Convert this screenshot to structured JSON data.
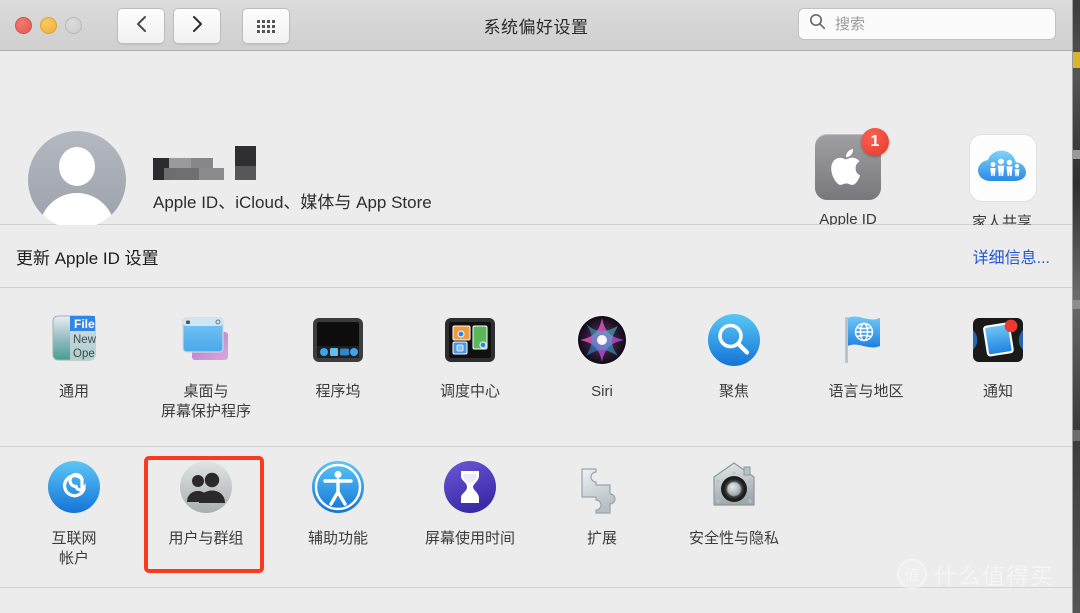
{
  "window": {
    "title": "系统偏好设置",
    "traffic_lights": [
      {
        "name": "close",
        "color": "#e15a52"
      },
      {
        "name": "minimize",
        "color": "#f0b03a"
      },
      {
        "name": "zoom",
        "color": "#cbcbcb"
      }
    ],
    "nav": {
      "back_icon": "chevron-left-icon",
      "forward_icon": "chevron-right-icon",
      "grid_icon": "show-all-grid-icon"
    },
    "search": {
      "placeholder": "搜索",
      "value": "",
      "icon": "search-icon"
    }
  },
  "account": {
    "avatar_icon": "user-avatar-icon",
    "name_redacted": true,
    "subtitle": "Apple ID、iCloud、媒体与 App Store",
    "tiles": [
      {
        "label": "Apple ID",
        "icon": "apple-logo-icon",
        "badge": "1",
        "badge_color": "#e23a2b"
      },
      {
        "label": "家人共享",
        "icon": "family-sharing-cloud-icon",
        "badge": null
      }
    ]
  },
  "update_banner": {
    "message": "更新 Apple ID 设置",
    "link": "详细信息...",
    "link_color": "#2158d0"
  },
  "preferences": {
    "row1": [
      {
        "label": "通用",
        "icon": "general-icon",
        "label2": ""
      },
      {
        "label": "桌面与",
        "label2": "屏幕保护程序",
        "icon": "desktop-screensaver-icon"
      },
      {
        "label": "程序坞",
        "label2": "",
        "icon": "dock-icon"
      },
      {
        "label": "调度中心",
        "label2": "",
        "icon": "mission-control-icon"
      },
      {
        "label": "Siri",
        "label2": "",
        "icon": "siri-icon"
      },
      {
        "label": "聚焦",
        "label2": "",
        "icon": "spotlight-icon"
      },
      {
        "label": "语言与地区",
        "label2": "",
        "icon": "language-region-icon"
      },
      {
        "label": "通知",
        "label2": "",
        "icon": "notifications-icon"
      }
    ],
    "row2": [
      {
        "label": "互联网",
        "label2": "帐户",
        "icon": "internet-accounts-icon"
      },
      {
        "label": "用户与群组",
        "label2": "",
        "icon": "users-groups-icon",
        "highlighted": true
      },
      {
        "label": "辅助功能",
        "label2": "",
        "icon": "accessibility-icon"
      },
      {
        "label": "屏幕使用时间",
        "label2": "",
        "icon": "screen-time-icon"
      },
      {
        "label": "扩展",
        "label2": "",
        "icon": "extensions-icon"
      },
      {
        "label": "安全性与隐私",
        "label2": "",
        "icon": "security-privacy-icon"
      }
    ]
  },
  "annotation": {
    "highlight_color": "#f93a1e",
    "target": "用户与群组"
  },
  "watermark": {
    "logo_text": "值",
    "text": "什么值得买"
  }
}
